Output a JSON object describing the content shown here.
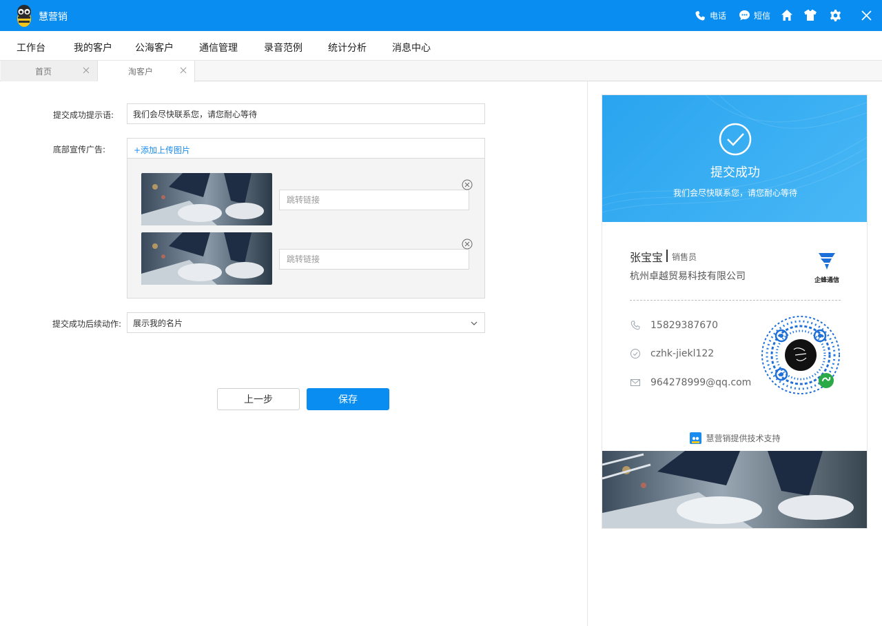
{
  "app": {
    "title": "慧营销"
  },
  "titlebar": {
    "phone_label": "电话",
    "sms_label": "短信"
  },
  "menu": {
    "items": [
      "工作台",
      "我的客户",
      "公海客户",
      "通信管理",
      "录音范例",
      "统计分析",
      "消息中心"
    ]
  },
  "tabs": [
    {
      "label": "首页"
    },
    {
      "label": "淘客户"
    }
  ],
  "form": {
    "success_tip_label": "提交成功提示语:",
    "success_tip_value": "我们会尽快联系您，请您耐心等待",
    "ad_label": "底部宣传广告:",
    "add_image_link": "+添加上传图片",
    "ads": [
      {
        "link_placeholder": "跳转链接"
      },
      {
        "link_placeholder": "跳转链接"
      }
    ],
    "after_action_label": "提交成功后续动作:",
    "after_action_value": "展示我的名片",
    "prev_button": "上一步",
    "save_button": "保存"
  },
  "preview": {
    "success_title": "提交成功",
    "success_message": "我们会尽快联系您，请您耐心等待",
    "name": "张宝宝",
    "role": "销售员",
    "company": "杭州卓越贸易科技有限公司",
    "company_logo_text": "企蜂通信",
    "phone": "15829387670",
    "wechat": "czhk-jiekl122",
    "email": "964278999@qq.com",
    "powered_by": "慧营销提供技术支持"
  },
  "colors": {
    "brand": "#0a8df0",
    "link": "#1a8cf0"
  }
}
